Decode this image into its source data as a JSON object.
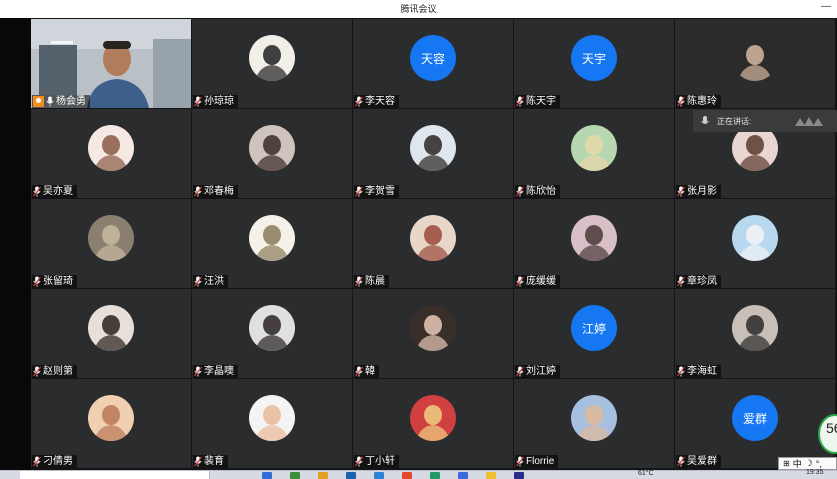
{
  "window": {
    "title": "腾讯会议",
    "minimize_glyph": "—"
  },
  "speaking_indicator": {
    "label": "正在讲话:"
  },
  "participants": [
    {
      "name": "杨会勇",
      "type": "video",
      "host": true
    },
    {
      "name": "孙琼琼",
      "type": "photo",
      "palette": [
        "#f2efe9",
        "#202020"
      ]
    },
    {
      "name": "李天容",
      "type": "text",
      "avatar_text": "天容"
    },
    {
      "name": "陈天宇",
      "type": "text",
      "avatar_text": "天宇"
    },
    {
      "name": "陈惠玲",
      "type": "photo",
      "palette": [
        "#2b2b2b",
        "#d8b8a0"
      ]
    },
    {
      "name": "吴亦夏",
      "type": "photo",
      "palette": [
        "#f6e9e4",
        "#8a5a44"
      ]
    },
    {
      "name": "邓春梅",
      "type": "photo",
      "palette": [
        "#cfc4bc",
        "#3a2a26"
      ]
    },
    {
      "name": "李贺雪",
      "type": "photo",
      "palette": [
        "#dfe6ee",
        "#2a2422"
      ]
    },
    {
      "name": "陈欣怡",
      "type": "photo",
      "palette": [
        "#b7d7b0",
        "#e8d9a8"
      ]
    },
    {
      "name": "张月影",
      "type": "photo",
      "palette": [
        "#e9d6d0",
        "#5a3a30"
      ]
    },
    {
      "name": "张留琦",
      "type": "photo",
      "palette": [
        "#8b8070",
        "#c8b8a0"
      ]
    },
    {
      "name": "汪洪",
      "type": "photo",
      "palette": [
        "#f4f1e8",
        "#8a7a5a"
      ]
    },
    {
      "name": "陈晨",
      "type": "photo",
      "palette": [
        "#e8d6c8",
        "#9a4a3a"
      ]
    },
    {
      "name": "庞缓缓",
      "type": "photo",
      "palette": [
        "#d9c0c8",
        "#4a3a3a"
      ]
    },
    {
      "name": "章珍凤",
      "type": "photo",
      "palette": [
        "#b8d8f0",
        "#f4f4f4"
      ]
    },
    {
      "name": "赵则第",
      "type": "photo",
      "palette": [
        "#e8e0d8",
        "#2a2020"
      ]
    },
    {
      "name": "李晶噢",
      "type": "photo",
      "palette": [
        "#e0e0e0",
        "#2a2222"
      ]
    },
    {
      "name": "韓",
      "type": "photo",
      "palette": [
        "#3a2e2a",
        "#e8c8b8"
      ]
    },
    {
      "name": "刘江婷",
      "type": "text",
      "avatar_text": "江婷"
    },
    {
      "name": "李海虹",
      "type": "photo",
      "palette": [
        "#c8c0b8",
        "#2a2a2a"
      ]
    },
    {
      "name": "刁倩男",
      "type": "photo",
      "palette": [
        "#f0d0b0",
        "#b87858"
      ]
    },
    {
      "name": "裴育",
      "type": "photo",
      "palette": [
        "#f4f4f4",
        "#e8b898"
      ]
    },
    {
      "name": "丁小轩",
      "type": "photo",
      "palette": [
        "#d04040",
        "#f0d080"
      ]
    },
    {
      "name": "Florrie",
      "type": "photo",
      "palette": [
        "#a8c0e0",
        "#e0b898"
      ]
    },
    {
      "name": "吴爱群",
      "type": "text",
      "avatar_text": "爱群"
    }
  ],
  "timer": {
    "value": "56"
  },
  "ime": {
    "mode": "中"
  },
  "taskbar": {
    "temperature": "61°C",
    "time": "19:35"
  },
  "colors": {
    "text_avatar_bg": "#1677f2",
    "tile_bg": "#2b2c2e",
    "host_badge": "#f28c1a"
  }
}
